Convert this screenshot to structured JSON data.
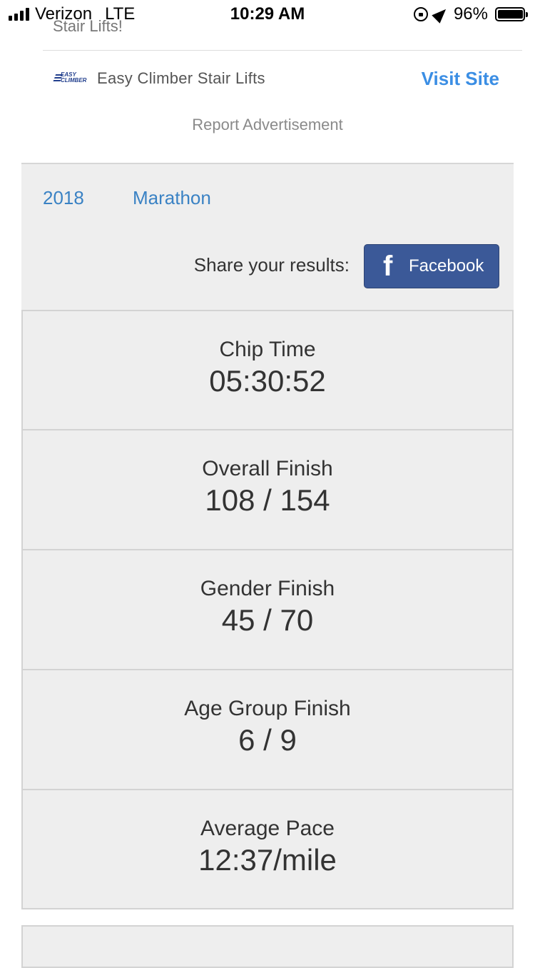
{
  "status_bar": {
    "carrier": "Verizon",
    "network": "LTE",
    "time": "10:29 AM",
    "battery_percent": "96%",
    "icons": [
      "signal-icon",
      "orientation-lock-icon",
      "location-arrow-icon",
      "battery-icon"
    ]
  },
  "ad": {
    "cut_text": "Stair Lifts!",
    "logo_text_line1": "EASY",
    "logo_text_line2": "CLIMBER",
    "advertiser": "Easy Climber Stair Lifts",
    "cta": "Visit Site",
    "report": "Report Advertisement"
  },
  "result": {
    "year": "2018",
    "race": "Marathon",
    "share_label": "Share your results:",
    "facebook_label": "Facebook",
    "facebook_color": "#3b5998",
    "link_color": "#3a82c4"
  },
  "stats": [
    {
      "label": "Chip Time",
      "value": "05:30:52"
    },
    {
      "label": "Overall Finish",
      "value": "108 / 154"
    },
    {
      "label": "Gender Finish",
      "value": "45 / 70"
    },
    {
      "label": "Age Group Finish",
      "value": "6 / 9"
    },
    {
      "label": "Average Pace",
      "value": "12:37/mile"
    }
  ]
}
